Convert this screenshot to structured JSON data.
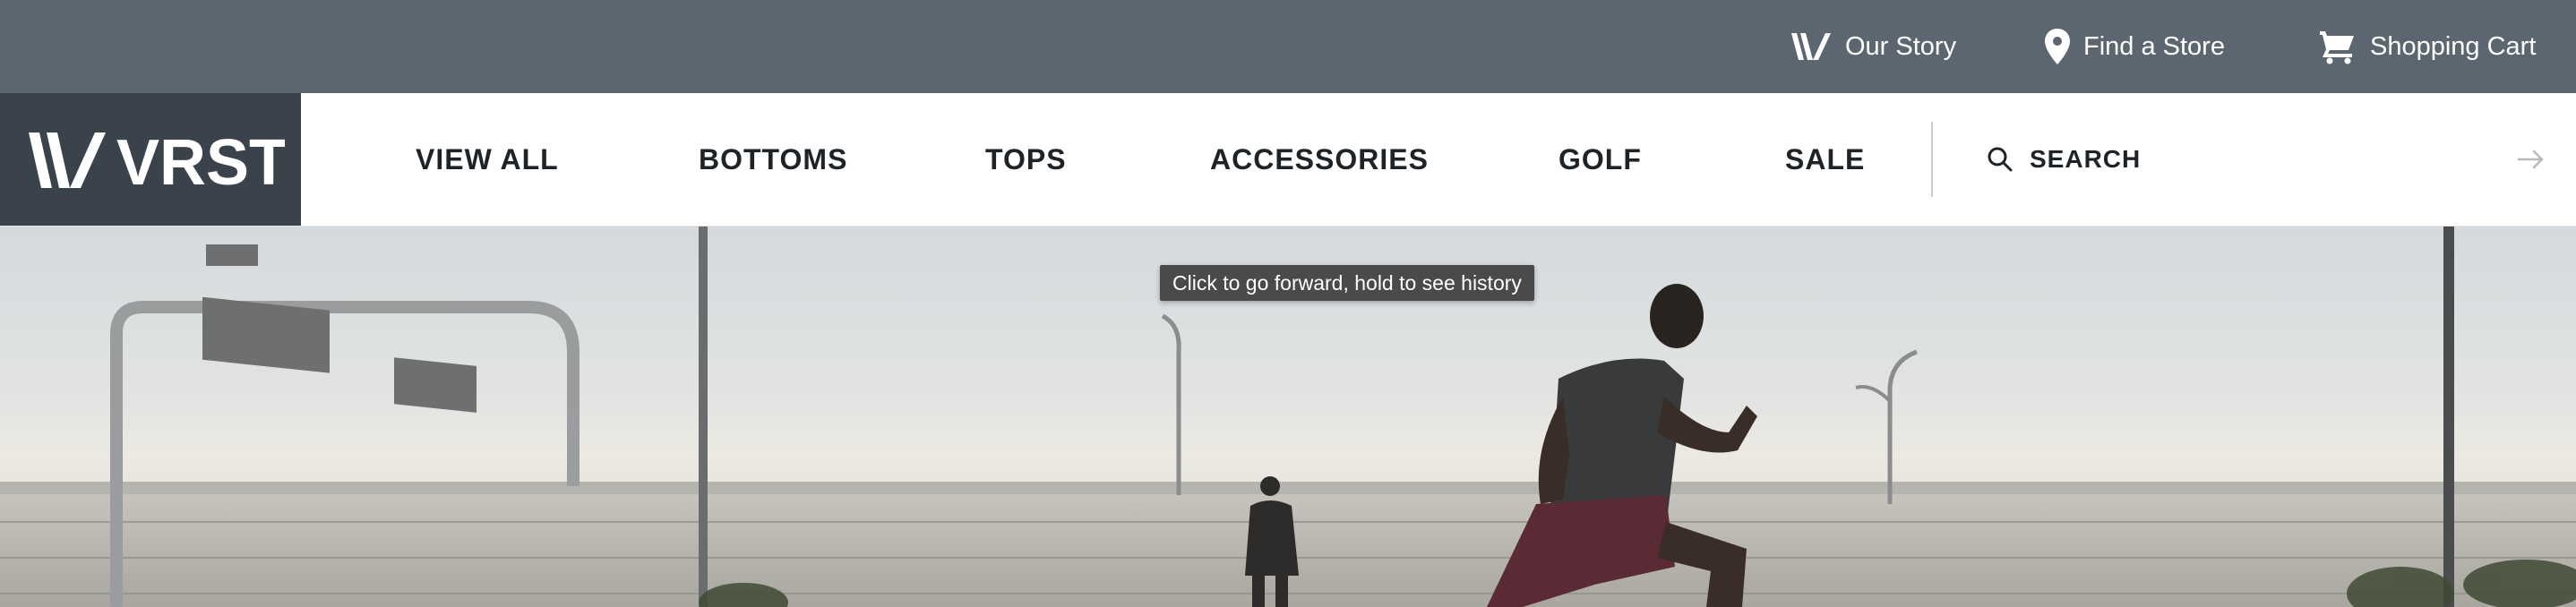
{
  "utility": {
    "our_story": "Our Story",
    "find_store": "Find a Store",
    "cart": "Shopping Cart"
  },
  "brand": {
    "name": "VRST"
  },
  "nav": {
    "items": [
      "VIEW ALL",
      "BOTTOMS",
      "TOPS",
      "ACCESSORIES",
      "GOLF",
      "SALE"
    ]
  },
  "search": {
    "placeholder": "SEARCH",
    "value": ""
  },
  "tooltip": {
    "text": "Click to go forward, hold to see history"
  },
  "colors": {
    "utility_bar": "#5c6670",
    "logo_bg": "#3a434c",
    "nav_text": "#1e2328"
  },
  "icons": {
    "our_story": "brand-mark-icon",
    "find_store": "map-pin-icon",
    "cart": "shopping-cart-icon",
    "search": "search-icon",
    "submit": "arrow-right-icon"
  }
}
